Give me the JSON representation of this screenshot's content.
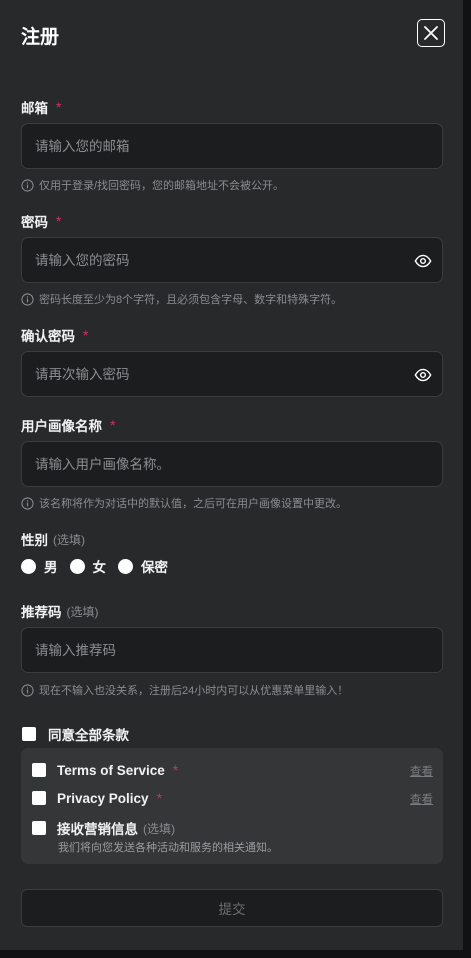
{
  "title": "注册",
  "required_mark": "*",
  "email": {
    "label": "邮箱",
    "placeholder": "请输入您的邮箱",
    "hint": "仅用于登录/找回密码，您的邮箱地址不会被公开。"
  },
  "password": {
    "label": "密码",
    "placeholder": "请输入您的密码",
    "hint": "密码长度至少为8个字符，且必须包含字母、数字和特殊字符。"
  },
  "confirm_password": {
    "label": "确认密码",
    "placeholder": "请再次输入密码"
  },
  "persona_name": {
    "label": "用户画像名称",
    "placeholder": "请输入用户画像名称。",
    "hint": "该名称将作为对话中的默认值，之后可在用户画像设置中更改。"
  },
  "gender": {
    "label": "性别",
    "optional": "(选填)",
    "options": [
      "男",
      "女",
      "保密"
    ]
  },
  "referral": {
    "label": "推荐码",
    "optional": "(选填)",
    "placeholder": "请输入推荐码",
    "hint": "现在不输入也没关系，注册后24小时内可以从优惠菜单里输入！"
  },
  "agree_all": "同意全部条款",
  "terms": [
    {
      "label": "Terms of Service",
      "link": "查看"
    },
    {
      "label": "Privacy Policy",
      "link": "查看"
    }
  ],
  "marketing": {
    "label": "接收营销信息",
    "optional": "(选填)",
    "note": "我们将向您发送各种活动和服务的相关通知。"
  },
  "submit_label": "提交"
}
